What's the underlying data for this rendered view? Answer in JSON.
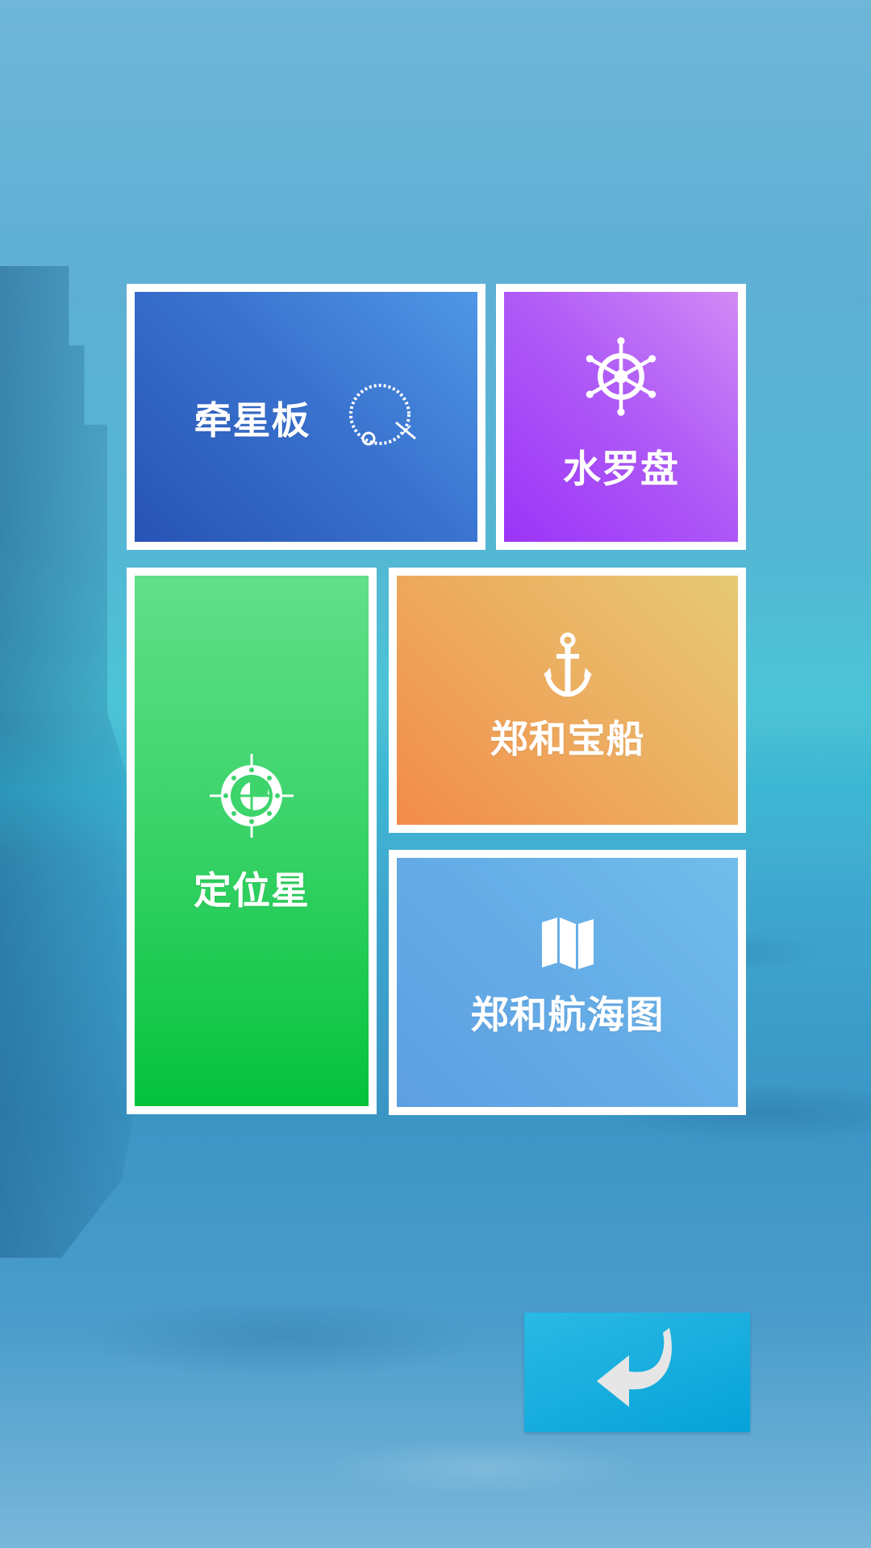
{
  "menu": {
    "tiles": [
      {
        "id": "lasso",
        "label": "牵星板",
        "icon": "lasso-rope-icon",
        "color": "#3a73cf"
      },
      {
        "id": "compass",
        "label": "水罗盘",
        "icon": "ship-wheel-icon",
        "color": "#b05cf7"
      },
      {
        "id": "position",
        "label": "定位星",
        "icon": "crosshair-compass-icon",
        "color": "#27cc55"
      },
      {
        "id": "ship",
        "label": "郑和宝船",
        "icon": "anchor-icon",
        "color": "#ecb062"
      },
      {
        "id": "map",
        "label": "郑和航海图",
        "icon": "folded-map-icon",
        "color": "#66aee7"
      }
    ]
  },
  "back_button": {
    "icon": "return-arrow-icon",
    "color": "#18aede"
  }
}
